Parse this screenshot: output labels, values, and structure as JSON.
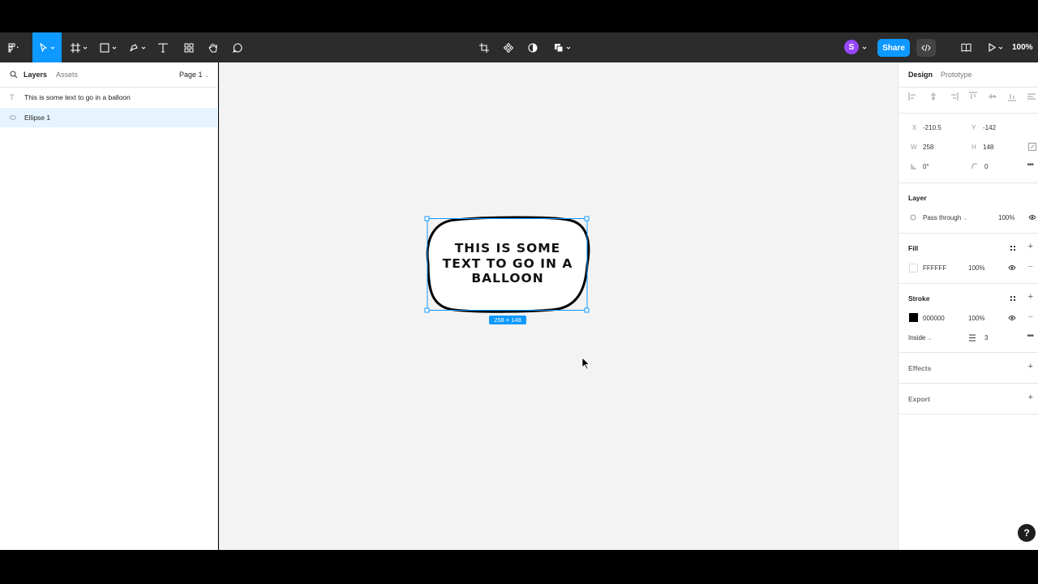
{
  "toolbar": {
    "share_label": "Share",
    "avatar_initial": "S",
    "zoom": "100%"
  },
  "left_panel": {
    "tabs": {
      "layers": "Layers",
      "assets": "Assets"
    },
    "page_selector": "Page 1",
    "layers": [
      {
        "name": "This is some text to go in a balloon",
        "type": "text",
        "icon": "T"
      },
      {
        "name": "Ellipse 1",
        "type": "ellipse",
        "icon": "⬭"
      }
    ]
  },
  "canvas": {
    "balloon_text": "THIS IS SOME TEXT TO GO IN A BALLOON",
    "size_badge": "258 × 148",
    "selection_color": "#0d99ff"
  },
  "right_panel": {
    "tabs": {
      "design": "Design",
      "prototype": "Prototype"
    },
    "position": {
      "x_label": "X",
      "x": "-210.5",
      "y_label": "Y",
      "y": "-142"
    },
    "size": {
      "w_label": "W",
      "w": "258",
      "h_label": "H",
      "h": "148"
    },
    "rotation": "0°",
    "corner_radius": "0",
    "layer": {
      "title": "Layer",
      "blend": "Pass through",
      "opacity": "100%"
    },
    "fill": {
      "title": "Fill",
      "color": "FFFFFF",
      "opacity": "100%"
    },
    "stroke": {
      "title": "Stroke",
      "color": "000000",
      "opacity": "100%",
      "position": "Inside",
      "weight": "3"
    },
    "effects": {
      "title": "Effects"
    },
    "export": {
      "title": "Export"
    }
  },
  "help_label": "?"
}
